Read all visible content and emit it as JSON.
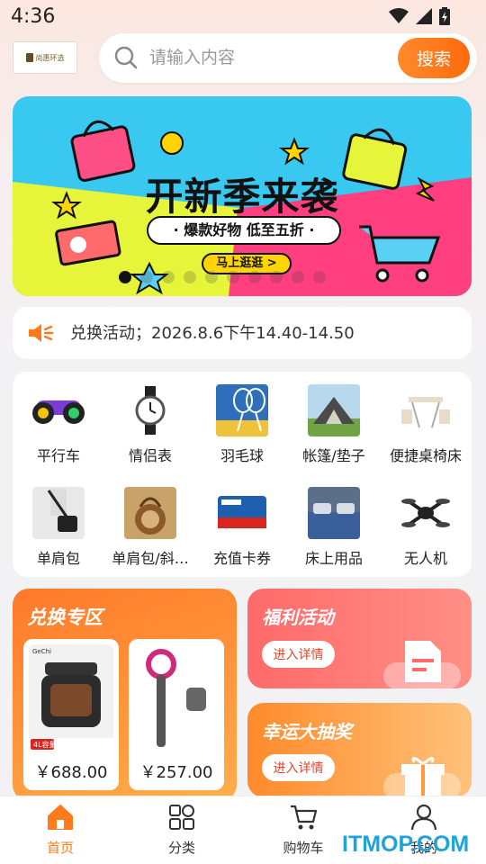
{
  "status": {
    "time": "4:36"
  },
  "logo": {
    "text": "尚惠环选"
  },
  "search": {
    "placeholder": "请输入内容",
    "button": "搜索"
  },
  "banner": {
    "title": "开新季来袭",
    "subtitle": "· 爆款好物 低至五折 ·",
    "cta": "马上逛逛 >",
    "dots": 10,
    "active_dot": 0
  },
  "notice": {
    "text": "兑换活动；2026.8.6下午14.40-14.50"
  },
  "categories": [
    {
      "label": "平行车",
      "icon": "hoverboard"
    },
    {
      "label": "情侣表",
      "icon": "watch"
    },
    {
      "label": "羽毛球",
      "icon": "badminton"
    },
    {
      "label": "帐篷/垫子",
      "icon": "tent"
    },
    {
      "label": "便捷桌椅床",
      "icon": "folding-table"
    },
    {
      "label": "单肩包",
      "icon": "shoulder-bag"
    },
    {
      "label": "单肩包/斜…",
      "icon": "round-bag"
    },
    {
      "label": "充值卡券",
      "icon": "recharge-card"
    },
    {
      "label": "床上用品",
      "icon": "bedding"
    },
    {
      "label": "无人机",
      "icon": "drone"
    }
  ],
  "exchange": {
    "title": "兑换专区",
    "products": [
      {
        "price": "￥688.00",
        "icon": "air-fryer",
        "brand": "GeChi",
        "badge": "4L容量"
      },
      {
        "price": "￥257.00",
        "icon": "hair-dryer"
      }
    ]
  },
  "promos": [
    {
      "title": "福利活动",
      "button": "进入详情"
    },
    {
      "title": "幸运大抽奖",
      "button": "进入详情"
    }
  ],
  "tabbar": [
    {
      "label": "首页",
      "active": true,
      "icon": "home"
    },
    {
      "label": "分类",
      "icon": "grid"
    },
    {
      "label": "购物车",
      "icon": "cart"
    },
    {
      "label": "我的",
      "icon": "user"
    }
  ],
  "watermark": "ITMOP.COM",
  "colors": {
    "accent": "#ff7a1a",
    "banner_yellow": "#e6f53a",
    "banner_pink": "#ff3f7f",
    "banner_blue": "#38c8f0"
  }
}
